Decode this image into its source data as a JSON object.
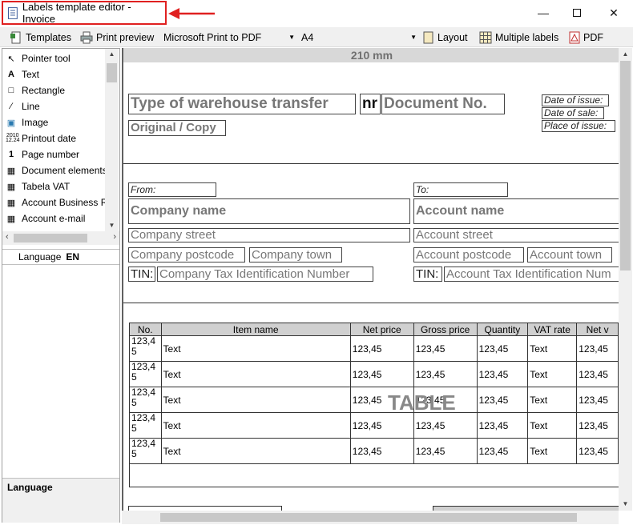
{
  "window": {
    "title": "Labels template editor - Invoice",
    "controls": [
      "minimize",
      "maximize",
      "close"
    ]
  },
  "toolbar": {
    "templates": "Templates",
    "print_preview": "Print preview",
    "printer": "Microsoft Print to PDF",
    "paper": "A4",
    "layout": "Layout",
    "multiple_labels": "Multiple labels",
    "pdf": "PDF"
  },
  "tools": [
    {
      "label": "Pointer tool",
      "icon": "pointer-icon"
    },
    {
      "label": "Text",
      "icon": "text-icon"
    },
    {
      "label": "Rectangle",
      "icon": "rectangle-icon"
    },
    {
      "label": "Line",
      "icon": "line-icon"
    },
    {
      "label": "Image",
      "icon": "image-icon"
    },
    {
      "label": "Printout date",
      "icon": "calendar-icon"
    },
    {
      "label": "Page number",
      "icon": "number-icon"
    },
    {
      "label": "Document elements",
      "icon": "grid-icon"
    },
    {
      "label": "Tabela VAT",
      "icon": "grid-icon"
    },
    {
      "label": "Account Business Re",
      "icon": "grid-icon"
    },
    {
      "label": "Account e-mail",
      "icon": "grid-icon"
    }
  ],
  "language_row": {
    "label": "Language",
    "value": "EN"
  },
  "language_footer": "Language",
  "ruler": "210 mm",
  "document": {
    "type": "Type of warehouse transfer",
    "nr": "nr",
    "doc_no": "Document No.",
    "original": "Original / Copy",
    "date_issue": "Date of issue:",
    "date_sale": "Date of sale:",
    "place_issue": "Place of issue:",
    "from": "From:",
    "to": "To:",
    "company_name": "Company name",
    "account_name": "Account name",
    "company_street": "Company street",
    "account_street": "Account street",
    "company_postcode": "Company postcode",
    "company_town": "Company town",
    "account_postcode": "Account postcode",
    "account_town": "Account town",
    "tin": "TIN:",
    "company_tin": "Company Tax Identification Number",
    "account_tin": "Account Tax Identification Num"
  },
  "table": {
    "headers": [
      "No.",
      "Item name",
      "Net price",
      "Gross price",
      "Quantity",
      "VAT rate",
      "Net v"
    ],
    "rows": [
      [
        "123,45",
        "Text",
        "123,45",
        "123,45",
        "123,45",
        "Text",
        "123,45"
      ],
      [
        "123,45",
        "Text",
        "123,45",
        "123,45",
        "123,45",
        "Text",
        "123,45"
      ],
      [
        "123,45",
        "Text",
        "123,45",
        "123,45",
        "123,45",
        "Text",
        "123,45"
      ],
      [
        "123,45",
        "Text",
        "123,45",
        "123,45",
        "123,45",
        "Text",
        "123,45"
      ],
      [
        "123,45",
        "Text",
        "123,45",
        "123,45",
        "123,45",
        "Text",
        "123,45"
      ]
    ],
    "watermark": "TABLE"
  }
}
